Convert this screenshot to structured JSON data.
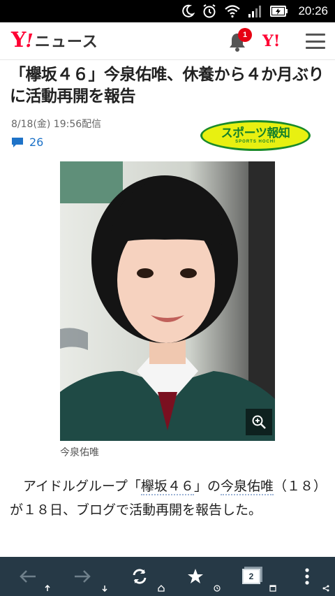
{
  "status_bar": {
    "time": "20:26"
  },
  "header": {
    "logo_y": "Y",
    "logo_bang": "!",
    "logo_news": "ニュース",
    "notification_count": "1",
    "yahoo_icon_label": "Y!"
  },
  "article": {
    "title": "「欅坂４６」今泉佑唯、休養から４か月ぶりに活動再開を報告",
    "date": "8/18(金) 19:56配信",
    "comment_count": "26",
    "source": {
      "name": "スポーツ報知",
      "name_en": "SPORTS HOCHI"
    },
    "photo_caption": "今泉佑唯",
    "body": {
      "part1": "　アイドルグループ「",
      "link1": "欅坂４６",
      "part2": "」の",
      "link2": "今泉佑唯",
      "part3": "（１８）が１８日、ブログで活動再開を報告した。"
    }
  },
  "colors": {
    "brand_red": "#ff0033",
    "link_blue": "#1e73c8",
    "nav_bg": "#263946",
    "badge_red": "#e60012"
  },
  "bottom_nav": {
    "tab_count": "2",
    "icons": [
      "back-arrow-icon",
      "forward-arrow-icon",
      "reload-icon",
      "bookmark-star-icon",
      "tabs-icon",
      "more-vertical-icon"
    ]
  }
}
